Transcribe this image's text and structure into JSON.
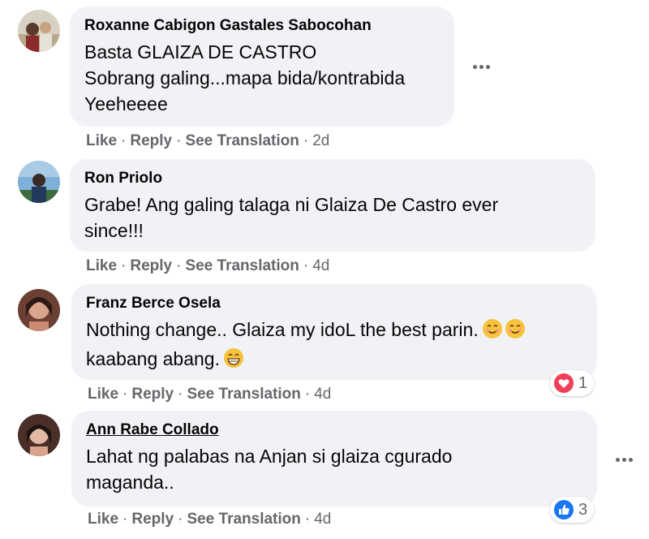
{
  "comments": [
    {
      "author": "Roxanne Cabigon Gastales Sabocohan",
      "lines": [
        "Basta GLAIZA DE CASTRO",
        "Sobrang galing...mapa bida/kontrabida",
        "Yeeheeee"
      ],
      "time": "2d"
    },
    {
      "author": "Ron Priolo",
      "lines": [
        "Grabe! Ang galing talaga ni Glaiza De Castro ever",
        "since!!!"
      ],
      "time": "4d"
    },
    {
      "author": "Franz Berce Osela",
      "lines": [
        "Nothing change.. Glaiza my idoL the best parin.",
        "kaabang abang."
      ],
      "time": "4d",
      "reaction": {
        "type": "heart-icon",
        "count": "1",
        "color": "#f33e58"
      }
    },
    {
      "author": "Ann Rabe Collado",
      "lines": [
        "Lahat ng palabas na Anjan si glaiza cgurado",
        "maganda.."
      ],
      "time": "4d",
      "reaction": {
        "type": "like-icon",
        "count": "3",
        "color": "#1877f2"
      }
    }
  ],
  "actions": {
    "like": "Like",
    "reply": "Reply",
    "see_translation": "See Translation",
    "separator": "·"
  },
  "colors": {
    "bubble": "#f0f2f5",
    "secondary_text": "#65676b",
    "heart": "#f33e58",
    "like": "#1877f2"
  }
}
